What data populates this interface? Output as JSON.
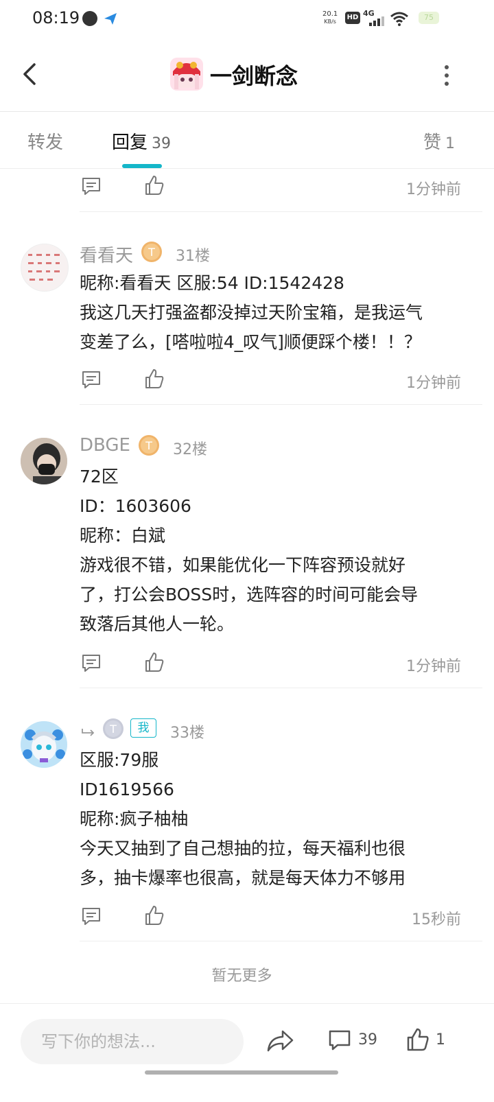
{
  "status_bar": {
    "time": "08:19",
    "net_speed_value": "20.1",
    "net_speed_unit": "KB/s",
    "hd_label": "HD",
    "network_label": "4G",
    "battery_level": "75"
  },
  "header": {
    "title": "一剑断念",
    "back_icon": "chevron-left-icon",
    "more_icon": "more-vertical-icon",
    "accent_color": "#14b6c9"
  },
  "tabs": [
    {
      "label": "转发",
      "count": ""
    },
    {
      "label": "回复",
      "count": "39"
    },
    {
      "label": "赞",
      "count": "1"
    }
  ],
  "top_actions": {
    "time": "1分钟前"
  },
  "posts": [
    {
      "username": "看看天",
      "floor": "31楼",
      "lines": [
        "昵称:看看天 区服:54 ID:1542428",
        "我这几天打强盗都没掉过天阶宝箱，是我运气",
        "变差了么，[嗒啦啦4_叹气]顺便踩个楼！！？"
      ],
      "time": "1分钟前"
    },
    {
      "username": "DBGE",
      "floor": "32楼",
      "lines": [
        "72区",
        "ID：1603606",
        "昵称：白斌",
        "游戏很不错，如果能优化一下阵容预设就好",
        "了，打公会BOSS时，选阵容的时间可能会导",
        "致落后其他人一轮。"
      ],
      "time": "1分钟前"
    },
    {
      "username": "",
      "me_badge": "我",
      "floor": "33楼",
      "lines": [
        "区服:79服",
        "ID1619566",
        "昵称:疯子柚柚",
        "今天又抽到了自己想抽的拉，每天福利也很",
        "多，抽卡爆率也很高，就是每天体力不够用"
      ],
      "time": "15秒前"
    }
  ],
  "no_more": "暂无更多",
  "bottom_bar": {
    "input_placeholder": "写下你的想法...",
    "comment_count": "39",
    "like_count": "1"
  }
}
